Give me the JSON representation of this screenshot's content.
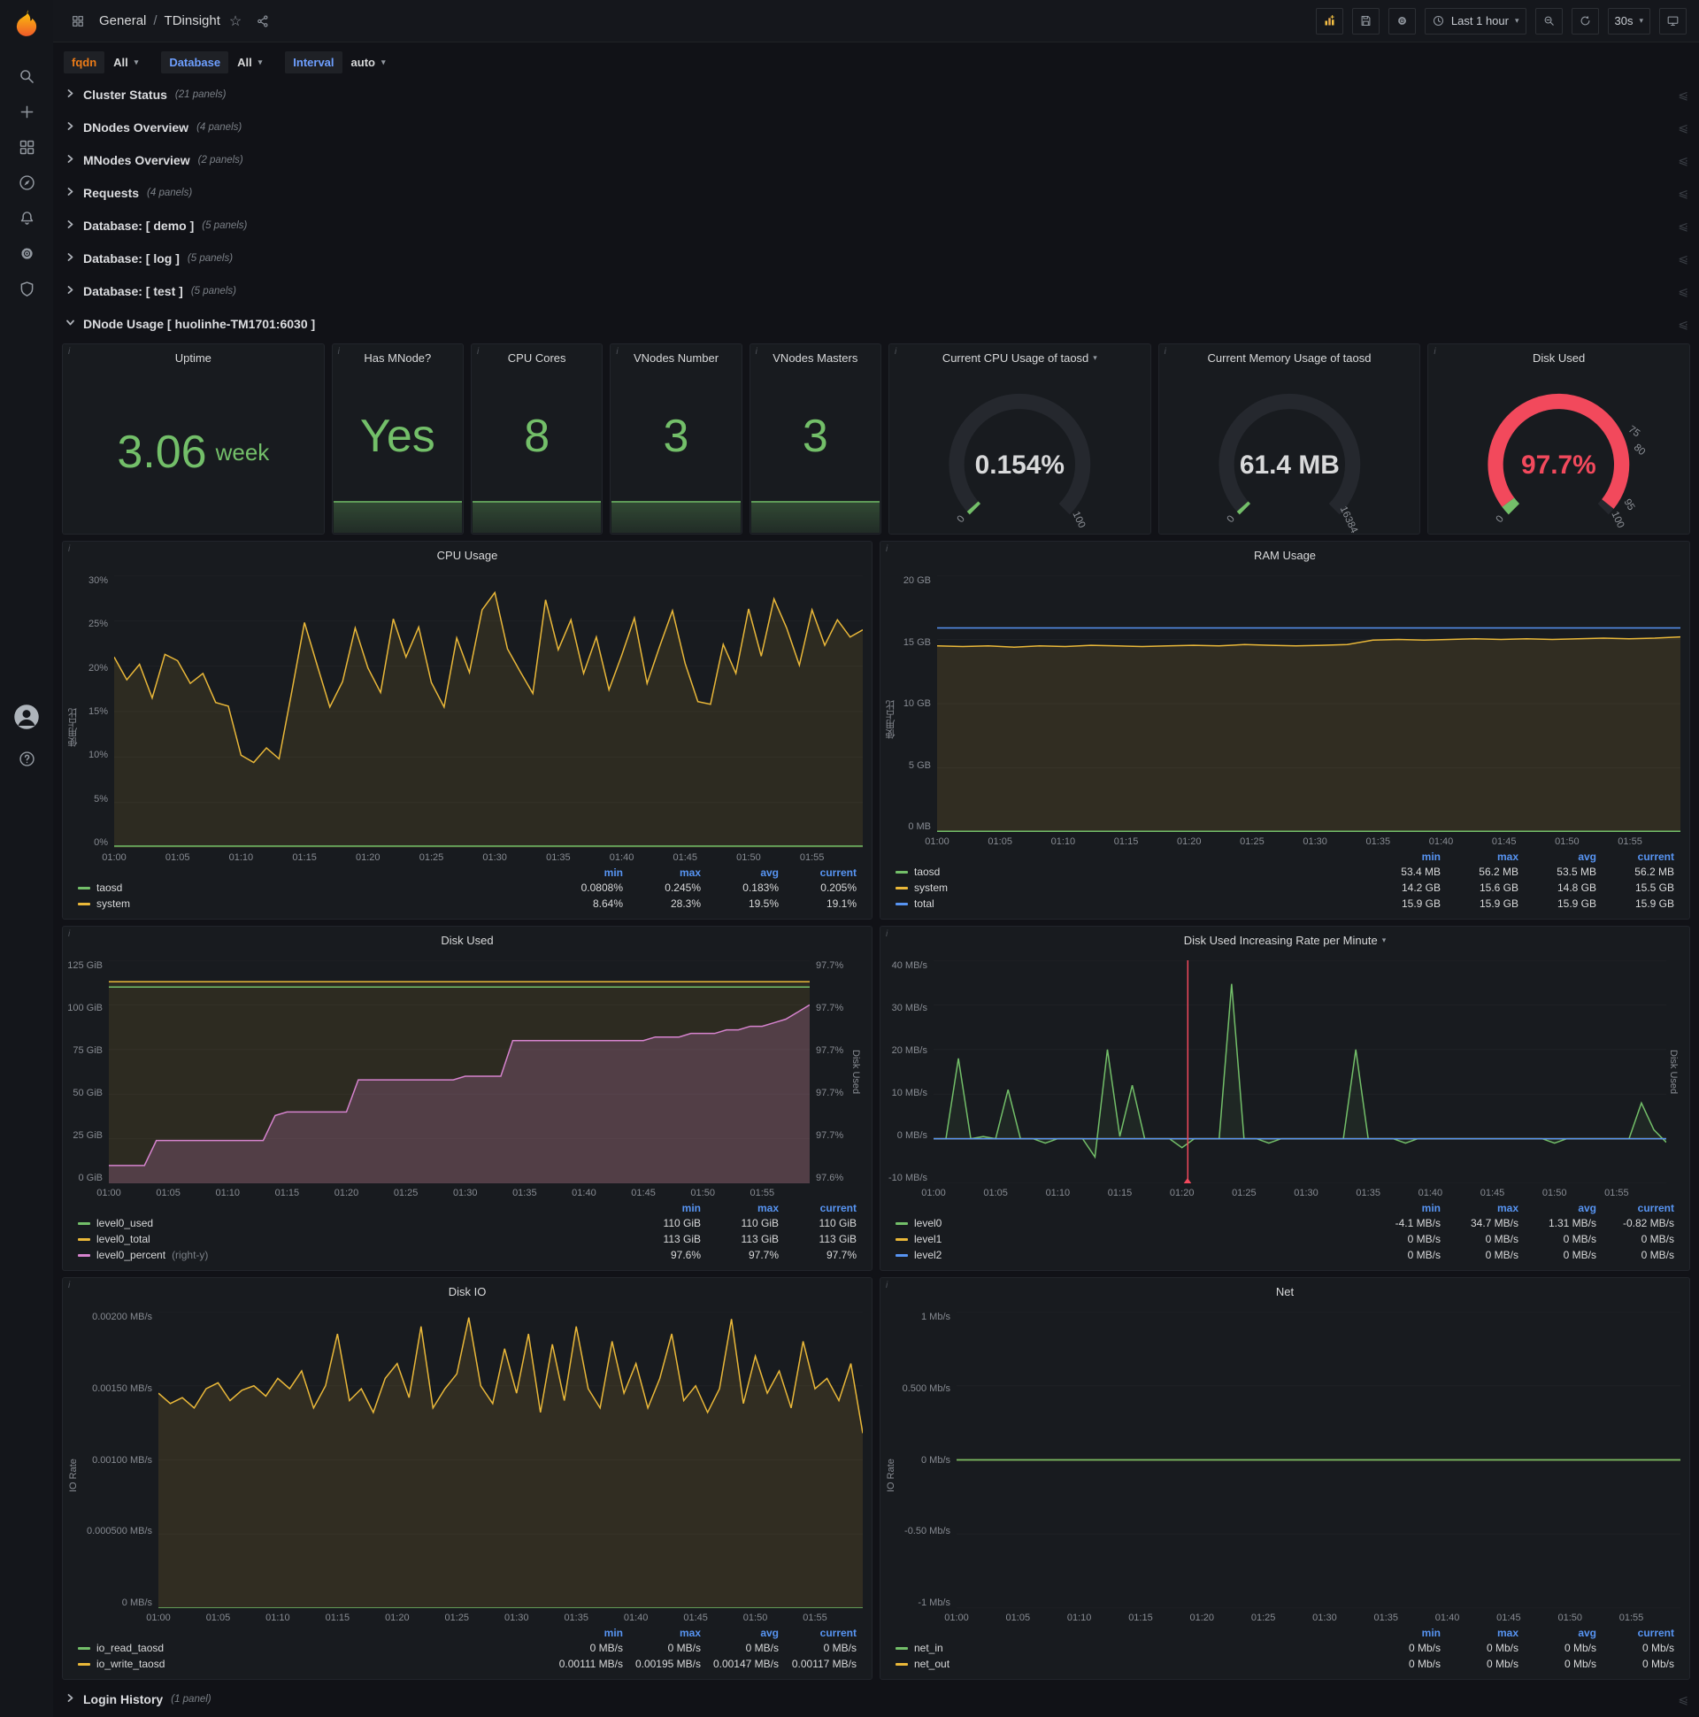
{
  "colors": {
    "green": "#73bf69",
    "yellow": "#eab839",
    "blue": "#5794f2",
    "red": "#f2495c",
    "pink": "#d683ce",
    "orange_label": "#eb7b18",
    "blue_label": "#6e9fff",
    "panel_bg": "#181b1f",
    "page_bg": "#111217"
  },
  "navbar": {
    "section": "General",
    "separator": "/",
    "title": "TDinsight",
    "time_range": "Last 1 hour",
    "refresh_interval": "30s"
  },
  "variables": [
    {
      "label": "fqdn",
      "value": "All"
    },
    {
      "label": "Database",
      "value": "All"
    },
    {
      "label": "Interval",
      "value": "auto"
    }
  ],
  "rows_top": [
    {
      "title": "Cluster Status",
      "count": "(21 panels)"
    },
    {
      "title": "DNodes Overview",
      "count": "(4 panels)"
    },
    {
      "title": "MNodes Overview",
      "count": "(2 panels)"
    },
    {
      "title": "Requests",
      "count": "(4 panels)"
    },
    {
      "title": "Database: [ demo ]",
      "count": "(5 panels)"
    },
    {
      "title": "Database: [ log ]",
      "count": "(5 panels)"
    },
    {
      "title": "Database: [ test ]",
      "count": "(5 panels)"
    }
  ],
  "expanded_row": {
    "title": "DNode Usage [ huolinhe-TM1701:6030 ]"
  },
  "rows_bottom": [
    {
      "title": "Login History",
      "count": "(1 panel)"
    }
  ],
  "stats": [
    {
      "title": "Uptime",
      "value": "3.06",
      "unit": "week"
    },
    {
      "title": "Has MNode?",
      "value": "Yes",
      "unit": ""
    },
    {
      "title": "CPU Cores",
      "value": "8",
      "unit": ""
    },
    {
      "title": "VNodes Number",
      "value": "3",
      "unit": ""
    },
    {
      "title": "VNodes Masters",
      "value": "3",
      "unit": ""
    }
  ],
  "gauges": [
    {
      "title": "Current CPU Usage of taosd",
      "value": "0.154%",
      "value_color": "#d8d9da",
      "tick_labels": [
        {
          "t": 0,
          "label": "0"
        },
        {
          "t": 1,
          "label": "100"
        }
      ],
      "segments": [
        {
          "from": 0,
          "to": 0.00154,
          "color": "#73bf69"
        }
      ]
    },
    {
      "title": "Current Memory Usage of taosd",
      "value": "61.4 MB",
      "value_color": "#d8d9da",
      "tick_labels": [
        {
          "t": 0,
          "label": "0"
        },
        {
          "t": 1,
          "label": "16384"
        }
      ],
      "segments": [
        {
          "from": 0,
          "to": 0.00375,
          "color": "#73bf69"
        }
      ]
    },
    {
      "title": "Disk Used",
      "value": "97.7%",
      "value_color": "#f2495c",
      "tick_labels": [
        {
          "t": 0,
          "label": "0"
        },
        {
          "t": 0.75,
          "label": "75"
        },
        {
          "t": 0.8,
          "label": "80"
        },
        {
          "t": 0.95,
          "label": "95"
        },
        {
          "t": 1,
          "label": "100"
        }
      ],
      "segments": [
        {
          "from": 0,
          "to": 0.03,
          "color": "#73bf69"
        },
        {
          "from": 0.03,
          "to": 0.977,
          "color": "#f2495c"
        }
      ]
    }
  ],
  "time_ticks": [
    "01:00",
    "01:05",
    "01:10",
    "01:15",
    "01:20",
    "01:25",
    "01:30",
    "01:35",
    "01:40",
    "01:45",
    "01:50",
    "01:55"
  ],
  "charts": {
    "cpu": {
      "title": "CPU Usage",
      "y_label": "使用占比",
      "yw": 38,
      "ymin": 0,
      "ymax": 30,
      "y_ticks": [
        "30%",
        "25%",
        "20%",
        "15%",
        "10%",
        "5%",
        "0%"
      ],
      "legend_cols": [
        "min",
        "max",
        "avg",
        "current"
      ],
      "legend": [
        {
          "name": "taosd",
          "color": "#73bf69",
          "values": [
            "0.0808%",
            "0.245%",
            "0.183%",
            "0.205%"
          ]
        },
        {
          "name": "system",
          "color": "#eab839",
          "values": [
            "8.64%",
            "28.3%",
            "19.5%",
            "19.1%"
          ]
        }
      ],
      "series": [
        {
          "name": "system",
          "color": "#eab839",
          "fill": "rgba(234,184,57,0.10)",
          "points": [
            21.0,
            18.5,
            20.2,
            16.5,
            21.3,
            20.6,
            18.1,
            19.2,
            16.0,
            15.6,
            10.2,
            9.4,
            11.0,
            9.8,
            17.2,
            24.8,
            20.1,
            15.5,
            18.3,
            24.2,
            19.8,
            17.1,
            25.2,
            21.0,
            24.3,
            18.2,
            15.5,
            23.1,
            19.3,
            26.2,
            28.1,
            21.9,
            19.4,
            17.0,
            27.3,
            21.8,
            25.1,
            19.2,
            23.2,
            17.4,
            21.2,
            25.3,
            18.1,
            22.2,
            26.1,
            20.3,
            16.1,
            15.8,
            22.4,
            19.2,
            26.3,
            21.1,
            27.4,
            24.2,
            20.1,
            26.2,
            22.3,
            25.1,
            23.2,
            24.0
          ]
        },
        {
          "name": "taosd",
          "color": "#73bf69",
          "points": [
            0.2,
            0.2
          ]
        }
      ]
    },
    "ram": {
      "title": "RAM Usage",
      "y_label": "使用占比",
      "yw": 44,
      "ymin": 0,
      "ymax": 20,
      "y_ticks": [
        "20 GB",
        "15 GB",
        "10 GB",
        "5 GB",
        "0 MB"
      ],
      "legend_cols": [
        "min",
        "max",
        "avg",
        "current"
      ],
      "legend": [
        {
          "name": "taosd",
          "color": "#73bf69",
          "values": [
            "53.4 MB",
            "56.2 MB",
            "53.5 MB",
            "56.2 MB"
          ]
        },
        {
          "name": "system",
          "color": "#eab839",
          "values": [
            "14.2 GB",
            "15.6 GB",
            "14.8 GB",
            "15.5 GB"
          ]
        },
        {
          "name": "total",
          "color": "#5794f2",
          "values": [
            "15.9 GB",
            "15.9 GB",
            "15.9 GB",
            "15.9 GB"
          ]
        }
      ],
      "series": [
        {
          "name": "system",
          "color": "#eab839",
          "fill": "rgba(234,184,57,0.12)",
          "points": [
            14.5,
            14.45,
            14.5,
            14.4,
            14.5,
            14.45,
            14.55,
            14.5,
            14.45,
            14.5,
            14.55,
            14.5,
            14.6,
            14.55,
            14.5,
            14.55,
            14.6,
            14.95,
            15.0,
            14.95,
            15.0,
            15.05,
            15.0,
            15.05,
            15.0,
            15.05,
            15.1,
            15.05,
            15.1,
            15.2
          ]
        },
        {
          "name": "total",
          "color": "#5794f2",
          "points": [
            15.9,
            15.9
          ]
        },
        {
          "name": "taosd",
          "color": "#73bf69",
          "points": [
            0.055,
            0.055
          ]
        }
      ]
    },
    "disk_used": {
      "title": "Disk Used",
      "yw": 48,
      "ymin": 0,
      "ymax": 125,
      "y_ticks": [
        "125 GiB",
        "100 GiB",
        "75 GiB",
        "50 GiB",
        "25 GiB",
        "0 GiB"
      ],
      "y_ticks_right": [
        "97.7%",
        "97.7%",
        "97.7%",
        "97.7%",
        "97.7%",
        "97.6%"
      ],
      "y_label_right": "Disk Used",
      "legend_cols": [
        "min",
        "max",
        "current"
      ],
      "legend": [
        {
          "name": "level0_used",
          "color": "#73bf69",
          "values": [
            "110 GiB",
            "110 GiB",
            "110 GiB"
          ]
        },
        {
          "name": "level0_total",
          "color": "#eab839",
          "values": [
            "113 GiB",
            "113 GiB",
            "113 GiB"
          ]
        },
        {
          "name": "level0_percent",
          "note": "(right-y)",
          "color": "#d683ce",
          "values": [
            "97.6%",
            "97.7%",
            "97.7%"
          ]
        }
      ],
      "series": [
        {
          "name": "level0_total",
          "color": "#eab839",
          "fill": "rgba(234,184,57,0.10)",
          "points": [
            113,
            113
          ]
        },
        {
          "name": "level0_used",
          "color": "#73bf69",
          "points": [
            110,
            110
          ]
        },
        {
          "name": "level0_percent",
          "color": "#d683ce",
          "fill": "rgba(214,131,206,0.22)",
          "y0": 97.6,
          "y1": 97.725,
          "points": [
            97.61,
            97.61,
            97.61,
            97.61,
            97.624,
            97.624,
            97.624,
            97.624,
            97.624,
            97.624,
            97.624,
            97.624,
            97.624,
            97.624,
            97.638,
            97.64,
            97.64,
            97.64,
            97.64,
            97.64,
            97.64,
            97.658,
            97.658,
            97.658,
            97.658,
            97.658,
            97.658,
            97.658,
            97.658,
            97.658,
            97.66,
            97.66,
            97.66,
            97.66,
            97.68,
            97.68,
            97.68,
            97.68,
            97.68,
            97.68,
            97.68,
            97.68,
            97.68,
            97.68,
            97.68,
            97.68,
            97.682,
            97.682,
            97.682,
            97.684,
            97.684,
            97.684,
            97.686,
            97.686,
            97.688,
            97.688,
            97.69,
            97.692,
            97.696,
            97.7
          ]
        }
      ]
    },
    "disk_rate": {
      "title": "Disk Used Increasing Rate per Minute",
      "has_caret": true,
      "yw": 56,
      "ymin": -10,
      "ymax": 40,
      "y_ticks": [
        "40 MB/s",
        "30 MB/s",
        "20 MB/s",
        "10 MB/s",
        "0 MB/s",
        "-10 MB/s"
      ],
      "y_label_right": "Disk Used",
      "annotation_x": 0.347,
      "legend_cols": [
        "min",
        "max",
        "avg",
        "current"
      ],
      "legend": [
        {
          "name": "level0",
          "color": "#73bf69",
          "values": [
            "-4.1 MB/s",
            "34.7 MB/s",
            "1.31 MB/s",
            "-0.82 MB/s"
          ]
        },
        {
          "name": "level1",
          "color": "#eab839",
          "values": [
            "0 MB/s",
            "0 MB/s",
            "0 MB/s",
            "0 MB/s"
          ]
        },
        {
          "name": "level2",
          "color": "#5794f2",
          "values": [
            "0 MB/s",
            "0 MB/s",
            "0 MB/s",
            "0 MB/s"
          ]
        }
      ],
      "series": [
        {
          "name": "level0",
          "color": "#73bf69",
          "fill": "rgba(115,191,105,0.08)",
          "fill_to": "zero",
          "points": [
            0,
            0,
            18,
            0,
            0.5,
            0,
            11,
            0,
            0,
            -1,
            0,
            0,
            0,
            -4.1,
            20,
            0.5,
            12,
            0,
            0,
            0,
            -2,
            0,
            0,
            0,
            34.7,
            0,
            0,
            -1,
            0,
            0,
            0,
            0,
            0,
            0,
            20,
            0,
            0,
            0,
            -1,
            0,
            0,
            0,
            0,
            0,
            0,
            0,
            0,
            0,
            0,
            0,
            -1,
            0,
            0,
            0,
            0,
            0,
            0,
            8,
            2,
            -0.82
          ]
        },
        {
          "name": "level1",
          "color": "#eab839",
          "points": [
            0,
            0
          ]
        },
        {
          "name": "level2",
          "color": "#5794f2",
          "points": [
            0,
            0
          ]
        }
      ]
    },
    "disk_io": {
      "title": "Disk IO",
      "y_label": "IO Rate",
      "yw": 88,
      "ymin": 0,
      "ymax": 0.002,
      "y_ticks": [
        "0.00200 MB/s",
        "0.00150 MB/s",
        "0.00100 MB/s",
        "0.000500 MB/s",
        "0 MB/s"
      ],
      "legend_cols": [
        "min",
        "max",
        "avg",
        "current"
      ],
      "legend": [
        {
          "name": "io_read_taosd",
          "color": "#73bf69",
          "values": [
            "0 MB/s",
            "0 MB/s",
            "0 MB/s",
            "0 MB/s"
          ]
        },
        {
          "name": "io_write_taosd",
          "color": "#eab839",
          "values": [
            "0.00111 MB/s",
            "0.00195 MB/s",
            "0.00147 MB/s",
            "0.00117 MB/s"
          ]
        }
      ],
      "series": [
        {
          "name": "io_write_taosd",
          "color": "#eab839",
          "fill": "rgba(234,184,57,0.12)",
          "points": [
            0.00145,
            0.00138,
            0.00142,
            0.00135,
            0.00148,
            0.00152,
            0.0014,
            0.00147,
            0.0015,
            0.00143,
            0.00155,
            0.00148,
            0.0016,
            0.00135,
            0.0015,
            0.00185,
            0.0014,
            0.00148,
            0.00132,
            0.00155,
            0.00165,
            0.00142,
            0.0019,
            0.00135,
            0.00148,
            0.00158,
            0.00196,
            0.0015,
            0.00138,
            0.00175,
            0.00145,
            0.00185,
            0.00132,
            0.00178,
            0.0014,
            0.0019,
            0.00148,
            0.00135,
            0.0018,
            0.00145,
            0.00165,
            0.00135,
            0.00155,
            0.00185,
            0.0014,
            0.0015,
            0.00132,
            0.00148,
            0.00195,
            0.00138,
            0.0017,
            0.00145,
            0.0016,
            0.00135,
            0.0018,
            0.00148,
            0.00155,
            0.0014,
            0.00165,
            0.00118
          ]
        },
        {
          "name": "io_read_taosd",
          "color": "#73bf69",
          "points": [
            0,
            0
          ]
        }
      ]
    },
    "net": {
      "title": "Net",
      "y_label": "IO Rate",
      "yw": 66,
      "ymin": -1,
      "ymax": 1,
      "y_ticks": [
        "1 Mb/s",
        "0.500 Mb/s",
        "0 Mb/s",
        "-0.50 Mb/s",
        "-1 Mb/s"
      ],
      "legend_cols": [
        "min",
        "max",
        "avg",
        "current"
      ],
      "legend": [
        {
          "name": "net_in",
          "color": "#73bf69",
          "values": [
            "0 Mb/s",
            "0 Mb/s",
            "0 Mb/s",
            "0 Mb/s"
          ]
        },
        {
          "name": "net_out",
          "color": "#eab839",
          "values": [
            "0 Mb/s",
            "0 Mb/s",
            "0 Mb/s",
            "0 Mb/s"
          ]
        }
      ],
      "series": [
        {
          "name": "net_out",
          "color": "#eab839",
          "points": [
            0,
            0
          ]
        },
        {
          "name": "net_in",
          "color": "#73bf69",
          "points": [
            0,
            0
          ]
        }
      ]
    }
  }
}
